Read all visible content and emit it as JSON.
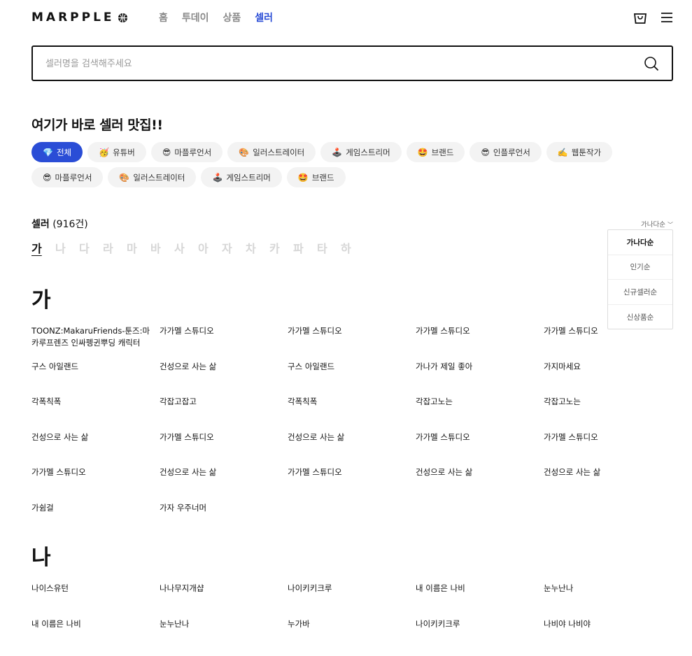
{
  "header": {
    "logo_text": "MARPPLE",
    "nav": [
      {
        "label": "홈",
        "active": false
      },
      {
        "label": "투데이",
        "active": false
      },
      {
        "label": "상품",
        "active": false
      },
      {
        "label": "셀러",
        "active": true
      }
    ]
  },
  "search": {
    "placeholder": "셀러명을 검색해주세요",
    "value": ""
  },
  "section_title": "여기가 바로 셀러 맛집!!",
  "chips": [
    {
      "emoji": "💎",
      "label": "전체",
      "active": true
    },
    {
      "emoji": "🥳",
      "label": "유튜버",
      "active": false
    },
    {
      "emoji": "😎",
      "label": "마플루언서",
      "active": false
    },
    {
      "emoji": "🎨",
      "label": "일러스트레이터",
      "active": false
    },
    {
      "emoji": "🕹️",
      "label": "게임스트리머",
      "active": false
    },
    {
      "emoji": "🤩",
      "label": "브랜드",
      "active": false
    },
    {
      "emoji": "😎",
      "label": "인플루언서",
      "active": false
    },
    {
      "emoji": "✍️",
      "label": "웹툰작가",
      "active": false
    },
    {
      "emoji": "😎",
      "label": "마플루언서",
      "active": false
    },
    {
      "emoji": "🎨",
      "label": "일러스트레이터",
      "active": false
    },
    {
      "emoji": "🕹️",
      "label": "게임스트리머",
      "active": false
    },
    {
      "emoji": "🤩",
      "label": "브랜드",
      "active": false
    }
  ],
  "seller_count": {
    "label": "셀러",
    "count": "(916건)"
  },
  "index": [
    {
      "label": "가",
      "active": true
    },
    {
      "label": "나",
      "active": false
    },
    {
      "label": "다",
      "active": false
    },
    {
      "label": "라",
      "active": false
    },
    {
      "label": "마",
      "active": false
    },
    {
      "label": "바",
      "active": false
    },
    {
      "label": "사",
      "active": false
    },
    {
      "label": "아",
      "active": false
    },
    {
      "label": "자",
      "active": false
    },
    {
      "label": "차",
      "active": false
    },
    {
      "label": "카",
      "active": false
    },
    {
      "label": "파",
      "active": false
    },
    {
      "label": "타",
      "active": false
    },
    {
      "label": "하",
      "active": false
    }
  ],
  "sort": {
    "current": "가나다순",
    "options": [
      {
        "label": "가나다순",
        "active": true
      },
      {
        "label": "인기순",
        "active": false
      },
      {
        "label": "신규셀러순",
        "active": false
      },
      {
        "label": "신상품순",
        "active": false
      }
    ]
  },
  "groups": [
    {
      "letter": "가",
      "sellers": [
        "TOONZ:MakaruFriends-툰즈:마카루프렌즈 인싸펭귄뿌딩 캐릭터",
        "가가멜 스튜디오",
        "가가멜 스튜디오",
        "가가멜 스튜디오",
        "가가멜 스튜디오",
        "구스 아일랜드",
        "건성으로 사는 삶",
        "구스 아일랜드",
        "가나가 제일 좋아",
        "가지마세요",
        "각폭칙폭",
        "각잡고잡고",
        "각폭칙폭",
        "각잡고노는",
        "각잡고노는",
        "건성으로 사는 삶",
        "가가멜 스튜디오",
        "건성으로 사는 삶",
        "가가멜 스튜디오",
        "가가멜 스튜디오",
        "가가멜 스튜디오",
        "건성으로 사는 삶",
        "가가멜 스튜디오",
        "건성으로 사는 삶",
        "건성으로 사는 삶",
        "가쉼걸",
        "가자 우주너머"
      ]
    },
    {
      "letter": "나",
      "sellers": [
        "나이스유턴",
        "나나무지개샵",
        "나이키키크루",
        "내 이름은 나비",
        "눈누난나",
        "내 이름은 나비",
        "눈누난나",
        "누가바",
        "나이키키크루",
        "나비야 나비야"
      ]
    }
  ],
  "icons": {
    "cart": "shopping-bag-icon",
    "menu": "hamburger-menu-icon",
    "search": "search-icon",
    "logo": "globe-icon"
  },
  "colors": {
    "accent": "#2a4dd6"
  }
}
